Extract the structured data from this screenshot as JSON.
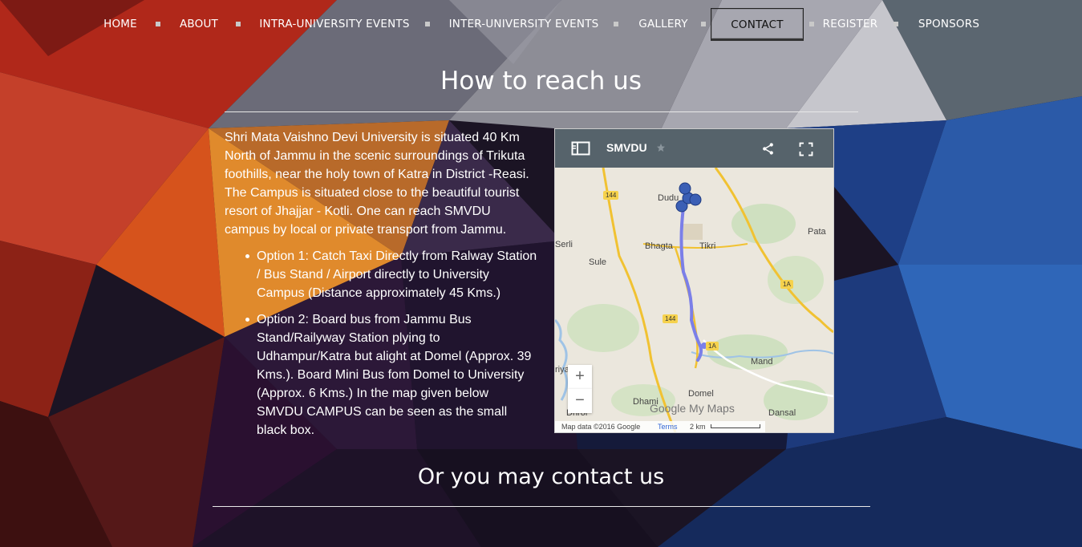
{
  "nav": {
    "items": [
      {
        "label": "HOME",
        "active": false
      },
      {
        "label": "ABOUT",
        "active": false
      },
      {
        "label": "INTRA-UNIVERSITY EVENTS",
        "active": false
      },
      {
        "label": "INTER-UNIVERSITY EVENTS",
        "active": false
      },
      {
        "label": "GALLERY",
        "active": false
      },
      {
        "label": "CONTACT",
        "active": true
      },
      {
        "label": "REGISTER",
        "active": false
      },
      {
        "label": "SPONSORS",
        "active": false
      }
    ]
  },
  "reach": {
    "title": "How to reach us",
    "intro": "Shri Mata Vaishno Devi University is situated 40 Km North of Jammu in the scenic surroundings of Trikuta foothills, near the holy town of Katra in District -Reasi. The Campus is situated close to the beautiful tourist resort of Jhajjar - Kotli. One can reach SMVDU campus by local or private transport from Jammu.",
    "options": [
      "Option 1: Catch Taxi Directly from Ralway Station / Bus Stand / Airport directly to University Campus (Distance approximately 45 Kms.)",
      "Option 2: Board bus from Jammu Bus Stand/Railyway Station plying to Udhampur/Katra but alight at Domel (Approx. 39 Kms.). Board Mini Bus fom Domel to University (Approx. 6 Kms.) In the map given below SMVDU CAMPUS can be seen as the small black box."
    ]
  },
  "map": {
    "title": "SMVDU",
    "icons": [
      "sidebar-toggle-icon",
      "star-icon",
      "share-icon",
      "fullscreen-icon"
    ],
    "places": {
      "dudu": "Dudu",
      "serli": "Serli",
      "sule": "Sule",
      "bhagta": "Bhagta",
      "tikri": "Tikri",
      "pata": "Pata",
      "mand": "Mand",
      "domel": "Domel",
      "dhami": "Dhami",
      "dansal": "Dansal",
      "dhrol": "Dhrol",
      "riya": "riya"
    },
    "roads": {
      "r144a": "144",
      "r144b": "144",
      "r1a_a": "1A",
      "r1a_b": "1A"
    },
    "zoom_in": "+",
    "zoom_out": "−",
    "brand": "Google My Maps",
    "attribution": "Map data ©2016 Google",
    "terms": "Terms",
    "scale": "2 km",
    "colors": {
      "header": "#56636b",
      "route": "#7b7fe8",
      "marker": "#3b5fb5",
      "road": "#f1c232"
    }
  },
  "contact": {
    "title": "Or you may contact us"
  }
}
